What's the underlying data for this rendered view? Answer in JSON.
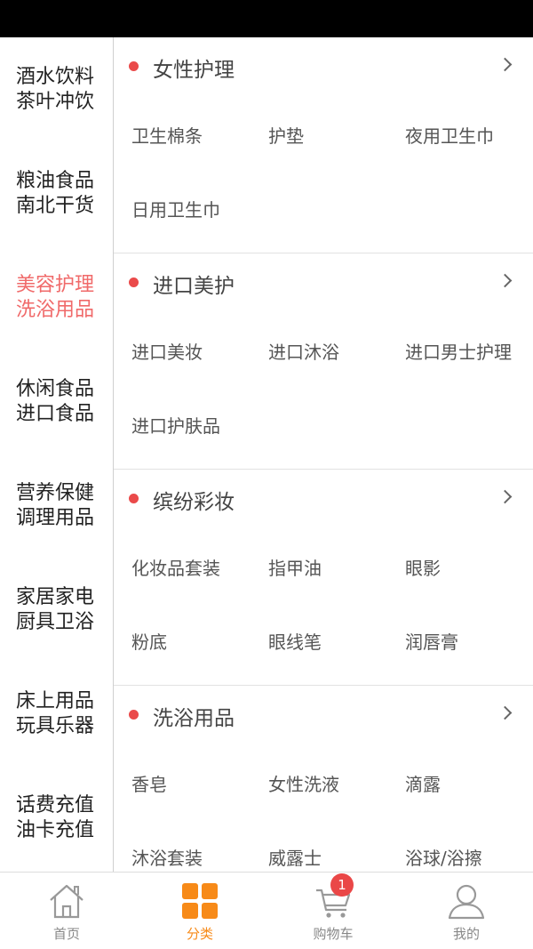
{
  "sidebar": {
    "items": [
      {
        "line1": "酒水饮料",
        "line2": "茶叶冲饮",
        "active": false
      },
      {
        "line1": "粮油食品",
        "line2": "南北干货",
        "active": false
      },
      {
        "line1": "美容护理",
        "line2": "洗浴用品",
        "active": true
      },
      {
        "line1": "休闲食品",
        "line2": "进口食品",
        "active": false
      },
      {
        "line1": "营养保健",
        "line2": "调理用品",
        "active": false
      },
      {
        "line1": "家居家电",
        "line2": "厨具卫浴",
        "active": false
      },
      {
        "line1": "床上用品",
        "line2": "玩具乐器",
        "active": false
      },
      {
        "line1": "话费充值",
        "line2": "油卡充值",
        "active": false
      }
    ]
  },
  "sections": [
    {
      "title": "女性护理",
      "items": [
        "卫生棉条",
        "护垫",
        "夜用卫生巾",
        "日用卫生巾"
      ]
    },
    {
      "title": "进口美护",
      "items": [
        "进口美妆",
        "进口沐浴",
        "进口男士护理",
        "进口护肤品"
      ]
    },
    {
      "title": "缤纷彩妆",
      "items": [
        "化妆品套装",
        "指甲油",
        "眼影",
        "粉底",
        "眼线笔",
        "润唇膏"
      ]
    },
    {
      "title": "洗浴用品",
      "items": [
        "香皂",
        "女性洗液",
        "滴露",
        "沐浴套装",
        "威露士",
        "浴球/浴擦"
      ]
    }
  ],
  "tabbar": {
    "home": {
      "label": "首页",
      "icon": "home-icon"
    },
    "category": {
      "label": "分类",
      "icon": "grid-icon"
    },
    "cart": {
      "label": "购物车",
      "icon": "cart-icon",
      "badge": "1"
    },
    "mine": {
      "label": "我的",
      "icon": "user-icon"
    }
  },
  "colors": {
    "accent": "#f78a18",
    "active_sidebar": "#f06a6a",
    "dot": "#ea4a4a",
    "badge": "#ea4747"
  }
}
